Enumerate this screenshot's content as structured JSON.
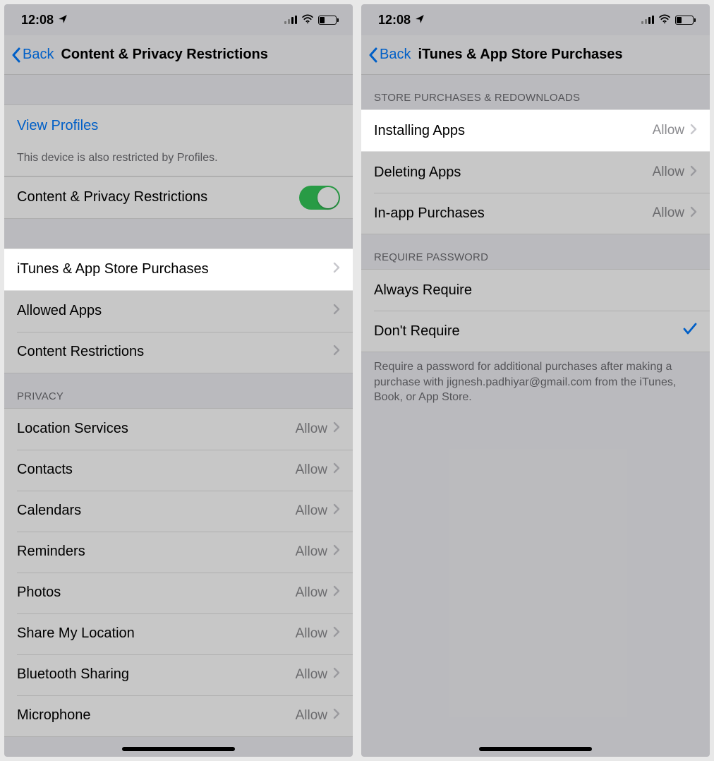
{
  "status": {
    "time": "12:08"
  },
  "left": {
    "back": "Back",
    "title": "Content & Privacy Restrictions",
    "viewProfiles": "View Profiles",
    "profilesNote": "This device is also restricted by Profiles.",
    "masterToggleLabel": "Content & Privacy Restrictions",
    "rows": {
      "itunes": "iTunes & App Store Purchases",
      "allowedApps": "Allowed Apps",
      "contentRestrictions": "Content Restrictions"
    },
    "privacyHeader": "Privacy",
    "privacy": [
      {
        "label": "Location Services",
        "value": "Allow"
      },
      {
        "label": "Contacts",
        "value": "Allow"
      },
      {
        "label": "Calendars",
        "value": "Allow"
      },
      {
        "label": "Reminders",
        "value": "Allow"
      },
      {
        "label": "Photos",
        "value": "Allow"
      },
      {
        "label": "Share My Location",
        "value": "Allow"
      },
      {
        "label": "Bluetooth Sharing",
        "value": "Allow"
      },
      {
        "label": "Microphone",
        "value": "Allow"
      }
    ]
  },
  "right": {
    "back": "Back",
    "title": "iTunes & App Store Purchases",
    "storeHeader": "Store Purchases & Redownloads",
    "store": [
      {
        "label": "Installing Apps",
        "value": "Allow"
      },
      {
        "label": "Deleting Apps",
        "value": "Allow"
      },
      {
        "label": "In-app Purchases",
        "value": "Allow"
      }
    ],
    "passwordHeader": "Require Password",
    "password": [
      {
        "label": "Always Require",
        "checked": false
      },
      {
        "label": "Don't Require",
        "checked": true
      }
    ],
    "footer": "Require a password for additional purchases after making a purchase with jignesh.padhiyar@gmail.com from the iTunes, Book, or App Store."
  }
}
